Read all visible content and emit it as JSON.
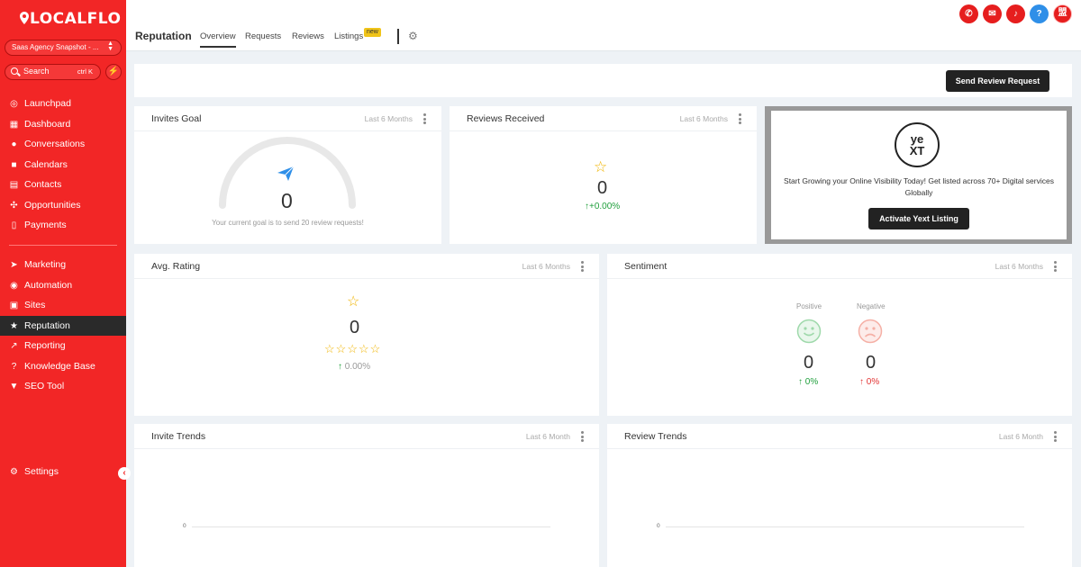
{
  "brand": {
    "name": "LOCALFLO",
    "accent": "#f22626"
  },
  "sidebar": {
    "account": "Saas Agency Snapshot - ...",
    "search_label": "Search",
    "search_shortcut": "ctrl K",
    "items": [
      {
        "label": "Launchpad",
        "icon": "rocket-icon"
      },
      {
        "label": "Dashboard",
        "icon": "dashboard-icon"
      },
      {
        "label": "Conversations",
        "icon": "chat-icon"
      },
      {
        "label": "Calendars",
        "icon": "calendar-icon"
      },
      {
        "label": "Contacts",
        "icon": "contacts-icon"
      },
      {
        "label": "Opportunities",
        "icon": "opportunities-icon"
      },
      {
        "label": "Payments",
        "icon": "payments-icon"
      }
    ],
    "items2": [
      {
        "label": "Marketing",
        "icon": "send-icon"
      },
      {
        "label": "Automation",
        "icon": "automation-icon"
      },
      {
        "label": "Sites",
        "icon": "sites-icon"
      },
      {
        "label": "Reputation",
        "icon": "star-icon"
      },
      {
        "label": "Reporting",
        "icon": "trend-icon"
      },
      {
        "label": "Knowledge Base",
        "icon": "help-icon"
      },
      {
        "label": "SEO Tool",
        "icon": "filter-icon"
      }
    ],
    "settings_label": "Settings"
  },
  "header": {
    "title": "Reputation",
    "tabs": [
      "Overview",
      "Requests",
      "Reviews",
      "Listings"
    ],
    "new_badge": "new",
    "avatar_text": "盟"
  },
  "actions": {
    "send_review_request": "Send Review Request"
  },
  "invites_goal": {
    "title": "Invites Goal",
    "period": "Last 6 Months",
    "value": "0",
    "note": "Your current goal is to send 20 review requests!"
  },
  "reviews_received": {
    "title": "Reviews Received",
    "period": "Last 6 Months",
    "value": "0",
    "change": "+0.00%"
  },
  "yext": {
    "logo_top": "ye",
    "logo_bottom": "XT",
    "text": "Start Growing your Online Visibility Today! Get listed across 70+ Digital services Globally",
    "button": "Activate Yext Listing"
  },
  "avg_rating": {
    "title": "Avg. Rating",
    "period": "Last 6 Months",
    "value": "0",
    "change": "0.00%"
  },
  "sentiment": {
    "title": "Sentiment",
    "period": "Last 6 Months",
    "positive_label": "Positive",
    "negative_label": "Negative",
    "positive_value": "0",
    "negative_value": "0",
    "positive_change": "0%",
    "negative_change": "0%"
  },
  "invite_trends": {
    "title": "Invite Trends",
    "period": "Last 6 Month",
    "axis_zero": "0"
  },
  "review_trends": {
    "title": "Review Trends",
    "period": "Last 6 Month",
    "axis_zero": "0"
  }
}
